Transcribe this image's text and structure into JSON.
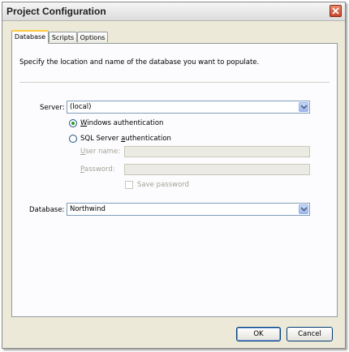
{
  "window": {
    "title": "Project Configuration"
  },
  "tabs": [
    {
      "label": "Database",
      "active": true
    },
    {
      "label": "Scripts",
      "active": false
    },
    {
      "label": "Options",
      "active": false
    }
  ],
  "database_tab": {
    "description": "Specify the location and name of the database you want to populate.",
    "server": {
      "label": "Server:",
      "value": "(local)"
    },
    "auth": {
      "windows_label_first": "W",
      "windows_label_rest": "indows authentication",
      "sql_label_first": "SQL Server ",
      "sql_label_u": "a",
      "sql_label_rest": "uthentication",
      "selected": "windows"
    },
    "username": {
      "label_u": "U",
      "label_rest": "ser name:",
      "value": ""
    },
    "password": {
      "label_u": "P",
      "label_rest": "assword:",
      "value": ""
    },
    "save_password": {
      "label": "Save password",
      "checked": false
    },
    "database": {
      "label": "Database:",
      "value": "Northwind"
    }
  },
  "buttons": {
    "ok": "OK",
    "cancel": "Cancel"
  },
  "colors": {
    "tab_highlight": "#ffc83c",
    "radio_dot": "#21a121",
    "input_border": "#7f9db9"
  }
}
